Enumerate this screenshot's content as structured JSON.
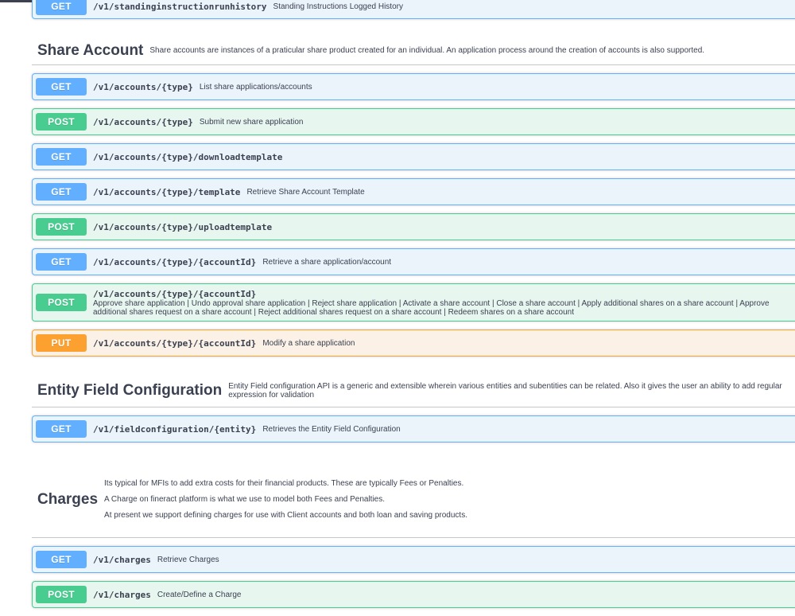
{
  "sections": {
    "top": {
      "ops": [
        {
          "method": "GET",
          "path": "/v1/standinginstructionrunhistory",
          "summary": "Standing Instructions Logged History"
        }
      ]
    },
    "share_account": {
      "title": "Share Account",
      "description": "Share accounts are instances of a praticular share product created for an individual. An application process around the creation of accounts is also supported.",
      "ops": [
        {
          "method": "GET",
          "path": "/v1/accounts/{type}",
          "summary": "List share applications/accounts"
        },
        {
          "method": "POST",
          "path": "/v1/accounts/{type}",
          "summary": "Submit new share application"
        },
        {
          "method": "GET",
          "path": "/v1/accounts/{type}/downloadtemplate",
          "summary": ""
        },
        {
          "method": "GET",
          "path": "/v1/accounts/{type}/template",
          "summary": "Retrieve Share Account Template"
        },
        {
          "method": "POST",
          "path": "/v1/accounts/{type}/uploadtemplate",
          "summary": ""
        },
        {
          "method": "GET",
          "path": "/v1/accounts/{type}/{accountId}",
          "summary": "Retrieve a share application/account"
        },
        {
          "method": "POST",
          "path": "/v1/accounts/{type}/{accountId}",
          "summary": "Approve share application | Undo approval share application | Reject share application | Activate a share account | Close a share account | Apply additional shares on a share account | Approve additional shares request on a share account | Reject additional shares request on a share account | Redeem shares on a share account"
        },
        {
          "method": "PUT",
          "path": "/v1/accounts/{type}/{accountId}",
          "summary": "Modify a share application"
        }
      ]
    },
    "entity_field": {
      "title": "Entity Field Configuration",
      "description": "Entity Field configuration API is a generic and extensible wherein various entities and subentities can be related. Also it gives the user an ability to add regular expression for validation",
      "ops": [
        {
          "method": "GET",
          "path": "/v1/fieldconfiguration/{entity}",
          "summary": "Retrieves the Entity Field Configuration"
        }
      ]
    },
    "charges": {
      "title": "Charges",
      "description": [
        "Its typical for MFIs to add extra costs for their financial products. These are typically Fees or Penalties.",
        "A Charge on fineract platform is what we use to model both Fees and Penalties.",
        "At present we support defining charges for use with Client accounts and both loan and saving products."
      ],
      "ops": [
        {
          "method": "GET",
          "path": "/v1/charges",
          "summary": "Retrieve Charges"
        },
        {
          "method": "POST",
          "path": "/v1/charges",
          "summary": "Create/Define a Charge"
        }
      ]
    }
  }
}
